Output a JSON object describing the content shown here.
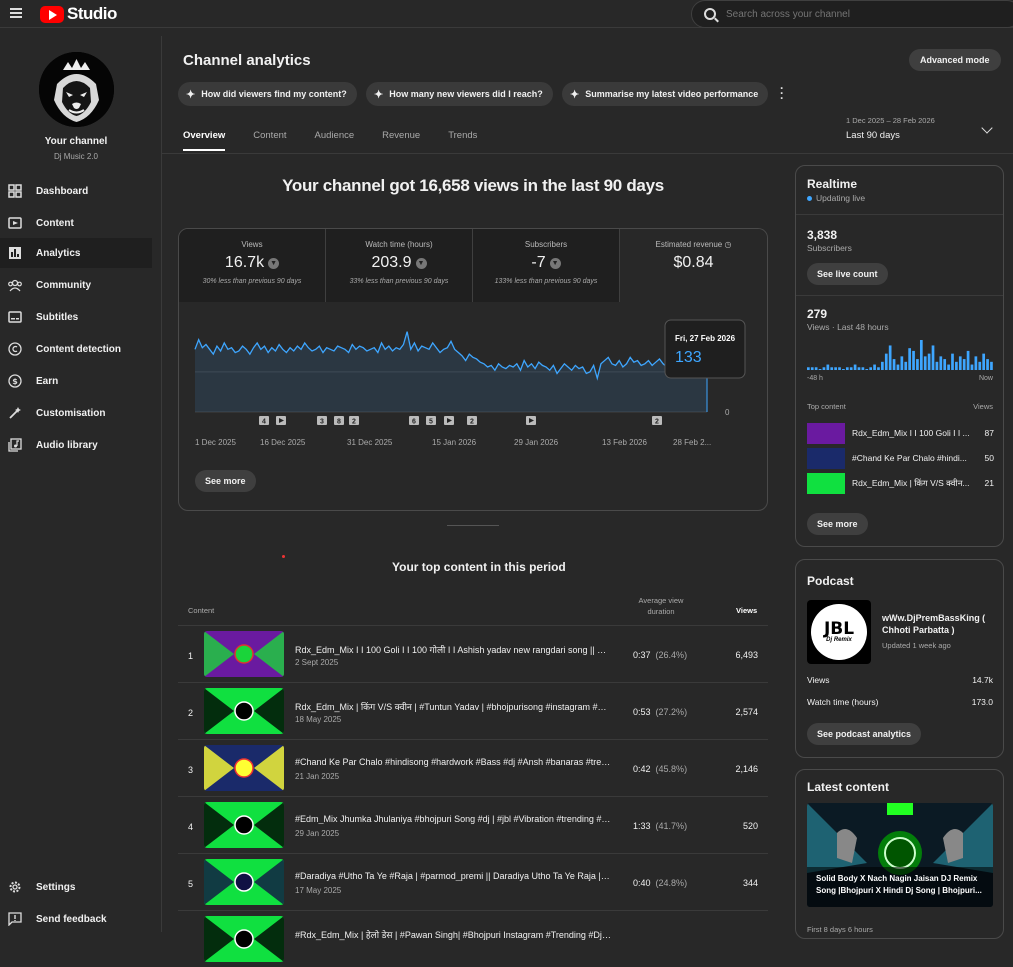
{
  "app": {
    "name": "Studio"
  },
  "search": {
    "placeholder": "Search across your channel"
  },
  "channel": {
    "name": "Your channel",
    "handle": "Dj Music 2.0"
  },
  "nav": [
    {
      "label": "Dashboard",
      "icon": "dashboard-icon"
    },
    {
      "label": "Content",
      "icon": "content-icon"
    },
    {
      "label": "Analytics",
      "icon": "analytics-icon"
    },
    {
      "label": "Community",
      "icon": "community-icon"
    },
    {
      "label": "Subtitles",
      "icon": "subtitles-icon"
    },
    {
      "label": "Content detection",
      "icon": "copyright-icon"
    },
    {
      "label": "Earn",
      "icon": "earn-icon"
    },
    {
      "label": "Customisation",
      "icon": "customisation-icon"
    },
    {
      "label": "Audio library",
      "icon": "audio-library-icon"
    }
  ],
  "nav_bottom": [
    {
      "label": "Settings"
    },
    {
      "label": "Send feedback"
    }
  ],
  "page": {
    "title": "Channel analytics",
    "advanced": "Advanced mode"
  },
  "chips": [
    "How did viewers find my content?",
    "How many new viewers did I reach?",
    "Summarise my latest video performance"
  ],
  "tabs": [
    "Overview",
    "Content",
    "Audience",
    "Revenue",
    "Trends"
  ],
  "range": {
    "dates": "1 Dec 2025 – 28 Feb 2026",
    "label": "Last 90 days"
  },
  "headline": "Your channel got 16,658 views in the last 90 days",
  "metrics": [
    {
      "label": "Views",
      "value": "16.7k",
      "compare": "30% less than previous 90 days"
    },
    {
      "label": "Watch time (hours)",
      "value": "203.9",
      "compare": "33% less than previous 90 days"
    },
    {
      "label": "Subscribers",
      "value": "-7",
      "compare": "133% less than previous 90 days"
    },
    {
      "label": "Estimated revenue",
      "value": "$0.84",
      "compare": ""
    }
  ],
  "chart_data": {
    "type": "line",
    "x_ticks": [
      "1 Dec 2025",
      "16 Dec 2025",
      "31 Dec 2025",
      "15 Jan 2026",
      "29 Jan 2026",
      "13 Feb 2026",
      "28 Feb 2..."
    ],
    "y_ticks": [
      0,
      125
    ],
    "ylim": [
      0,
      280
    ],
    "tooltip": {
      "date": "Fri, 27 Feb 2026",
      "value": "133"
    },
    "values": [
      195,
      225,
      200,
      210,
      195,
      180,
      205,
      190,
      215,
      195,
      200,
      185,
      190,
      205,
      195,
      180,
      200,
      215,
      195,
      205,
      185,
      200,
      190,
      210,
      195,
      185,
      200,
      190,
      205,
      195,
      215,
      200,
      190,
      195,
      205,
      185,
      200,
      195,
      190,
      205,
      200,
      195,
      185,
      210,
      195,
      205,
      200,
      190,
      195,
      200,
      185,
      215,
      195,
      205,
      190,
      200,
      195,
      210,
      250,
      195,
      215,
      190,
      205,
      200,
      195,
      215,
      200,
      185,
      195,
      200,
      220,
      195,
      185,
      175,
      160,
      180,
      170,
      165,
      155,
      150,
      140,
      145,
      130,
      150,
      140,
      135,
      145,
      140,
      150,
      130,
      160,
      140,
      150,
      135,
      155,
      145,
      140,
      130,
      145,
      120,
      135,
      150,
      140,
      130,
      145,
      135,
      140,
      120,
      125,
      145,
      105,
      150,
      160,
      170,
      150,
      145,
      160,
      140,
      150,
      170,
      155,
      160,
      145,
      150,
      160,
      145,
      155,
      165,
      150,
      140,
      150,
      135,
      145,
      160,
      150,
      135,
      145,
      140,
      120,
      150,
      133
    ],
    "markers": [
      "4",
      "play",
      "3",
      "8",
      "2",
      "6",
      "5",
      "play",
      "2",
      "play",
      "2"
    ]
  },
  "chart_see_more": "See more",
  "top_content": {
    "title": "Your top content in this period",
    "headers": {
      "content": "Content",
      "avd": "Average view duration",
      "views": "Views"
    },
    "rows": [
      {
        "rank": "1",
        "title": "Rdx_Edm_Mix I I 100 Goli I I 100 गोली I I Ashish yadav new rangdari song || #mag...",
        "date": "2 Sept 2025",
        "avd": "0:37",
        "pct": "(26.4%)",
        "views": "6,493"
      },
      {
        "rank": "2",
        "title": "Rdx_Edm_Mix | किंग V/S क्वीन | #Tuntun Yadav | #bhojpurisong #instagram #virals...",
        "date": "18 May 2025",
        "avd": "0:53",
        "pct": "(27.2%)",
        "views": "2,574"
      },
      {
        "rank": "3",
        "title": "#Chand Ke Par Chalo #hindisong #hardwork #Bass #dj #Ansh #banaras #trendi...",
        "date": "21 Jan 2025",
        "avd": "0:42",
        "pct": "(45.8%)",
        "views": "2,146"
      },
      {
        "rank": "4",
        "title": "#Edm_Mix Jhumka Jhulaniya #bhojpuri Song #dj | #jbl #Vibration #trending #so...",
        "date": "29 Jan 2025",
        "avd": "1:33",
        "pct": "(41.7%)",
        "views": "520"
      },
      {
        "rank": "5",
        "title": "#Daradiya #Utho Ta Ye #Raja | #parmod_premi || Daradiya Utho Ta Ye Raja | #bho...",
        "date": "17 May 2025",
        "avd": "0:40",
        "pct": "(24.8%)",
        "views": "344"
      },
      {
        "rank": "",
        "title": "#Rdx_Edm_Mix | हेलो डेस | #Pawan Singh| #Bhojpuri Instagram #Trending #Dj Ans...",
        "date": "",
        "avd": "",
        "pct": "",
        "views": ""
      }
    ]
  },
  "realtime": {
    "title": "Realtime",
    "live": "Updating live",
    "subs": "3,838",
    "subs_label": "Subscribers",
    "live_count": "See live count",
    "views": "279",
    "views_label": "Views · Last 48 hours",
    "axis_left": "-48 h",
    "axis_right": "Now",
    "bars": [
      1,
      1,
      1,
      0,
      1,
      2,
      1,
      1,
      1,
      0,
      1,
      1,
      2,
      1,
      1,
      0,
      1,
      2,
      1,
      3,
      6,
      9,
      4,
      2,
      5,
      3,
      8,
      7,
      4,
      11,
      5,
      6,
      9,
      3,
      5,
      4,
      2,
      6,
      3,
      5,
      4,
      7,
      2,
      5,
      3,
      6,
      4,
      3
    ],
    "top_label": "Top content",
    "views_col": "Views",
    "top": [
      {
        "title": "Rdx_Edm_Mix I I 100 Goli I I ...",
        "views": "87"
      },
      {
        "title": "#Chand Ke Par Chalo #hindi...",
        "views": "50"
      },
      {
        "title": "Rdx_Edm_Mix | किंग V/S क्वीन...",
        "views": "21"
      }
    ],
    "see_more": "See more"
  },
  "podcast": {
    "title": "Podcast",
    "name": "wWw.DjPremBassKing ( Chhoti Parbatta )",
    "updated": "Updated 1 week ago",
    "views_label": "Views",
    "views": "14.7k",
    "wt_label": "Watch time (hours)",
    "wt": "173.0",
    "button": "See podcast analytics",
    "logo": "JBL",
    "logo_sub": "Dj Remix"
  },
  "latest": {
    "title": "Latest content",
    "video": "Solid Body X Nach Nagin Jaisan DJ Remix Song |Bhojpuri X Hindi Dj Song | Bhojpuri...",
    "age": "First 8 days 6 hours"
  },
  "colors": {
    "accent": "#3ea6ff",
    "red": "#ff0000",
    "bg": "#282828"
  }
}
